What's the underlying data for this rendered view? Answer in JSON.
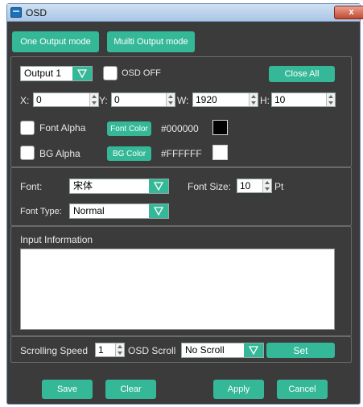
{
  "window": {
    "title": "OSD",
    "close_glyph": "x"
  },
  "tabs": [
    {
      "label": "One Output mode"
    },
    {
      "label": "Muilti Output mode"
    }
  ],
  "output": {
    "selected": "Output 1",
    "osd_off_label": "OSD OFF",
    "close_all_label": "Close All"
  },
  "geometry": {
    "x_label": "X:",
    "x_value": "0",
    "y_label": "Y:",
    "y_value": "0",
    "w_label": "W:",
    "w_value": "1920",
    "h_label": "H:",
    "h_value": "10"
  },
  "font_alpha": {
    "label": "Font Alpha",
    "color_button": "Font Color",
    "hex": "#000000",
    "swatch_color": "#000000"
  },
  "bg_alpha": {
    "label": "BG Alpha",
    "color_button": "BG Color",
    "hex": "#FFFFFF",
    "swatch_color": "#FFFFFF"
  },
  "font": {
    "label": "Font:",
    "value": "宋体",
    "size_label": "Font Size:",
    "size_value": "10",
    "size_unit": "Pt",
    "type_label": "Font Type:",
    "type_value": "Normal"
  },
  "input_info": {
    "label": "Input Information",
    "value": ""
  },
  "scroll": {
    "speed_label": "Scrolling Speed",
    "speed_value": "1",
    "osd_scroll_label": "OSD Scroll",
    "osd_scroll_value": "No Scroll",
    "set_label": "Set"
  },
  "footer": {
    "save_label": "Save",
    "clear_label": "Clear",
    "apply_label": "Apply",
    "cancel_label": "Cancel"
  },
  "colors": {
    "accent": "#35b897",
    "window_bg": "#3b3b3b",
    "title_bar": "#b7d0ec",
    "close_button": "#c4482f"
  }
}
